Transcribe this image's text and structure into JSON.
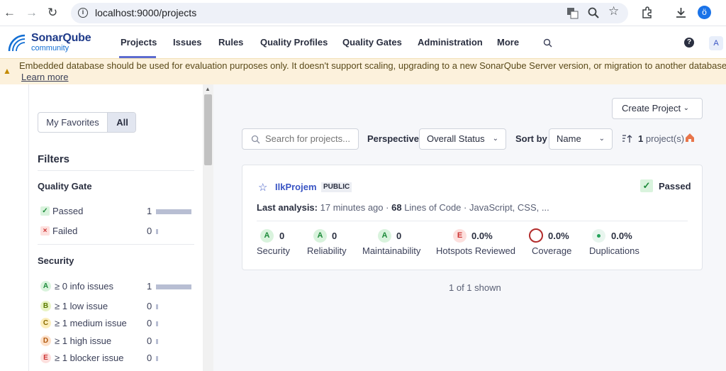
{
  "browser": {
    "url": "localhost:9000/projects",
    "profile_initial": "ö",
    "icons": [
      "back-icon",
      "forward-icon",
      "reload-icon",
      "translate-icon",
      "zoom-icon",
      "bookmark-star-icon",
      "extensions-icon",
      "download-icon"
    ]
  },
  "nav": {
    "logo_name": "SonarQube",
    "logo_sub": "community",
    "items": [
      "Projects",
      "Issues",
      "Rules",
      "Quality Profiles",
      "Quality Gates",
      "Administration",
      "More"
    ],
    "help": "?",
    "avatar": "A"
  },
  "banner": {
    "text": "Embedded database should be used for evaluation purposes only. It doesn't support scaling, upgrading to a new SonarQube Server version, or migration to another database engine.",
    "link": "Learn more"
  },
  "sidebar": {
    "toggle": {
      "favorites": "My Favorites",
      "all": "All"
    },
    "filters_title": "Filters",
    "quality_gate": {
      "title": "Quality Gate",
      "rows": [
        {
          "badge": "✓",
          "label": "Passed",
          "count": "1",
          "fraction": 1.0
        },
        {
          "badge": "×",
          "label": "Failed",
          "count": "0",
          "fraction": 0.0
        }
      ]
    },
    "security": {
      "title": "Security",
      "rows": [
        {
          "badge": "A",
          "label": "≥ 0 info issues",
          "count": "1",
          "fraction": 1.0
        },
        {
          "badge": "B",
          "label": "≥ 1 low issue",
          "count": "0",
          "fraction": 0.0
        },
        {
          "badge": "C",
          "label": "≥ 1 medium issue",
          "count": "0",
          "fraction": 0.0
        },
        {
          "badge": "D",
          "label": "≥ 1 high issue",
          "count": "0",
          "fraction": 0.0
        },
        {
          "badge": "E",
          "label": "≥ 1 blocker issue",
          "count": "0",
          "fraction": 0.0
        }
      ]
    }
  },
  "toolbar": {
    "create": "Create Project",
    "search_placeholder": "Search for projects...",
    "perspective_label": "Perspective",
    "perspective_value": "Overall Status",
    "sort_label": "Sort by",
    "sort_value": "Name",
    "count_num": "1",
    "count_text": "project(s)"
  },
  "project": {
    "name": "IlkProjem",
    "visibility": "PUBLIC",
    "gate": "Passed",
    "analysis_label": "Last analysis:",
    "analysis_time": "17 minutes ago",
    "loc": "68",
    "loc_label": "Lines of Code",
    "languages": "JavaScript, CSS, ...",
    "metrics": [
      {
        "rating": "A",
        "value": "0",
        "label": "Security"
      },
      {
        "rating": "A",
        "value": "0",
        "label": "Reliability"
      },
      {
        "rating": "A",
        "value": "0",
        "label": "Maintainability"
      },
      {
        "rating": "E",
        "value": "0.0%",
        "label": "Hotspots Reviewed"
      },
      {
        "rating": "",
        "value": "0.0%",
        "label": "Coverage"
      },
      {
        "rating": "",
        "value": "0.0%",
        "label": "Duplications"
      }
    ]
  },
  "footer": {
    "shown": "1 of 1 shown"
  },
  "colors": {
    "accent": "#5d6cd0",
    "link": "#3a55c4",
    "banner_bg": "#fcf1dc",
    "passed": "#1d8a3a",
    "coverage_ring": "#b22b2b"
  }
}
